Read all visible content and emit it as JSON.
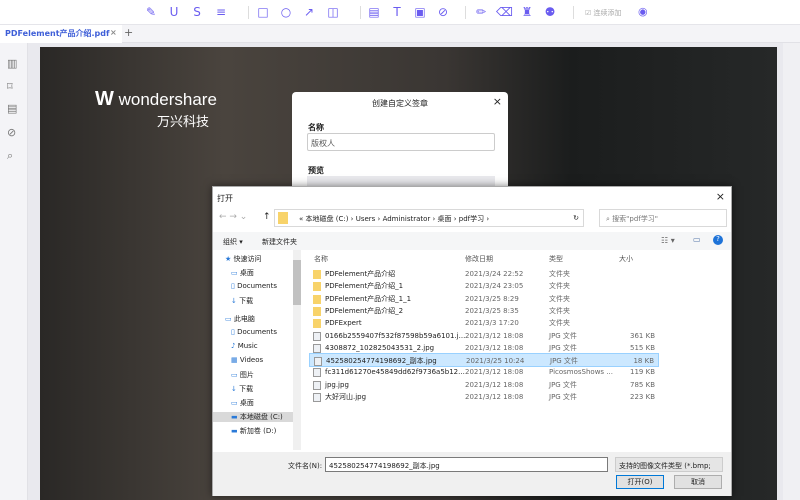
{
  "toolbar": {
    "icons": [
      "highlight-icon",
      "underline-icon",
      "strikethrough-icon",
      "list-icon",
      "rectangle-icon",
      "circle-icon",
      "arrow-icon",
      "shape-icon",
      "comment-icon",
      "text-icon",
      "textbox-icon",
      "attachment-icon",
      "pencil-icon",
      "eraser-icon",
      "stamp-icon",
      "signature-icon"
    ],
    "glyphs": [
      "✎",
      "U",
      "S",
      "≡",
      "□",
      "○",
      "↗",
      "◫",
      "▤",
      "T",
      "▣",
      "⊘",
      "✏",
      "⌫",
      "♜",
      "⚉"
    ],
    "continuous_add": "连续添加"
  },
  "tab": {
    "title": "PDFelement产品介绍.pdf",
    "close": "×",
    "add": "+"
  },
  "logo": {
    "name": "wondershare",
    "cn": "万兴科技"
  },
  "stamp_dialog": {
    "title": "创建自定义签章",
    "name_label": "名称",
    "name_value": "版权人",
    "preview_label": "预览"
  },
  "file_dialog": {
    "title": "打开",
    "path": [
      "本地磁盘 (C:)",
      "Users",
      "Administrator",
      "桌面",
      "pdf学习"
    ],
    "search_placeholder": "搜索\"pdf学习\"",
    "organize": "组织 ▾",
    "new_folder": "新建文件夹",
    "columns": [
      "名称",
      "修改日期",
      "类型",
      "大小"
    ],
    "nav": [
      {
        "label": "快速访问",
        "icon": "★"
      },
      {
        "label": "桌面",
        "icon": "▭"
      },
      {
        "label": "Documents",
        "icon": "▯"
      },
      {
        "label": "下载",
        "icon": "↓"
      },
      {
        "label": "此电脑",
        "icon": "▭"
      },
      {
        "label": "Documents",
        "icon": "▯"
      },
      {
        "label": "Music",
        "icon": "♪"
      },
      {
        "label": "Videos",
        "icon": "▦"
      },
      {
        "label": "图片",
        "icon": "▭"
      },
      {
        "label": "下载",
        "icon": "↓"
      },
      {
        "label": "桌面",
        "icon": "▭"
      },
      {
        "label": "本地磁盘 (C:)",
        "icon": "▬"
      },
      {
        "label": "新加卷 (D:)",
        "icon": "▬"
      }
    ],
    "files": [
      {
        "name": "PDFelement产品介绍",
        "date": "2021/3/24 22:52",
        "type": "文件夹",
        "size": ""
      },
      {
        "name": "PDFelement产品介绍_1",
        "date": "2021/3/24 23:05",
        "type": "文件夹",
        "size": ""
      },
      {
        "name": "PDFelement产品介绍_1_1",
        "date": "2021/3/25 8:29",
        "type": "文件夹",
        "size": ""
      },
      {
        "name": "PDFelement产品介绍_2",
        "date": "2021/3/25 8:35",
        "type": "文件夹",
        "size": ""
      },
      {
        "name": "PDFExpert",
        "date": "2021/3/3 17:20",
        "type": "文件夹",
        "size": ""
      },
      {
        "name": "0166b2559407f532f87598b59a6101.j...",
        "date": "2021/3/12 18:08",
        "type": "JPG 文件",
        "size": "361 KB"
      },
      {
        "name": "4308872_102825043531_2.jpg",
        "date": "2021/3/12 18:08",
        "type": "JPG 文件",
        "size": "515 KB"
      },
      {
        "name": "452580254774198692_副本.jpg",
        "date": "2021/3/25 10:24",
        "type": "JPG 文件",
        "size": "18 KB"
      },
      {
        "name": "fc311d61270e45849dd62f9736a5b12...",
        "date": "2021/3/12 18:08",
        "type": "PicosmosShows ...",
        "size": "119 KB"
      },
      {
        "name": "jpg.jpg",
        "date": "2021/3/12 18:08",
        "type": "JPG 文件",
        "size": "785 KB"
      },
      {
        "name": "大好河山.jpg",
        "date": "2021/3/12 18:08",
        "type": "JPG 文件",
        "size": "223 KB"
      }
    ],
    "filename_label": "文件名(N):",
    "filename_value": "452580254774198692_副本.jpg",
    "filter": "支持的图像文件类型 (*.bmp;",
    "open": "打开(O)",
    "cancel": "取消"
  }
}
